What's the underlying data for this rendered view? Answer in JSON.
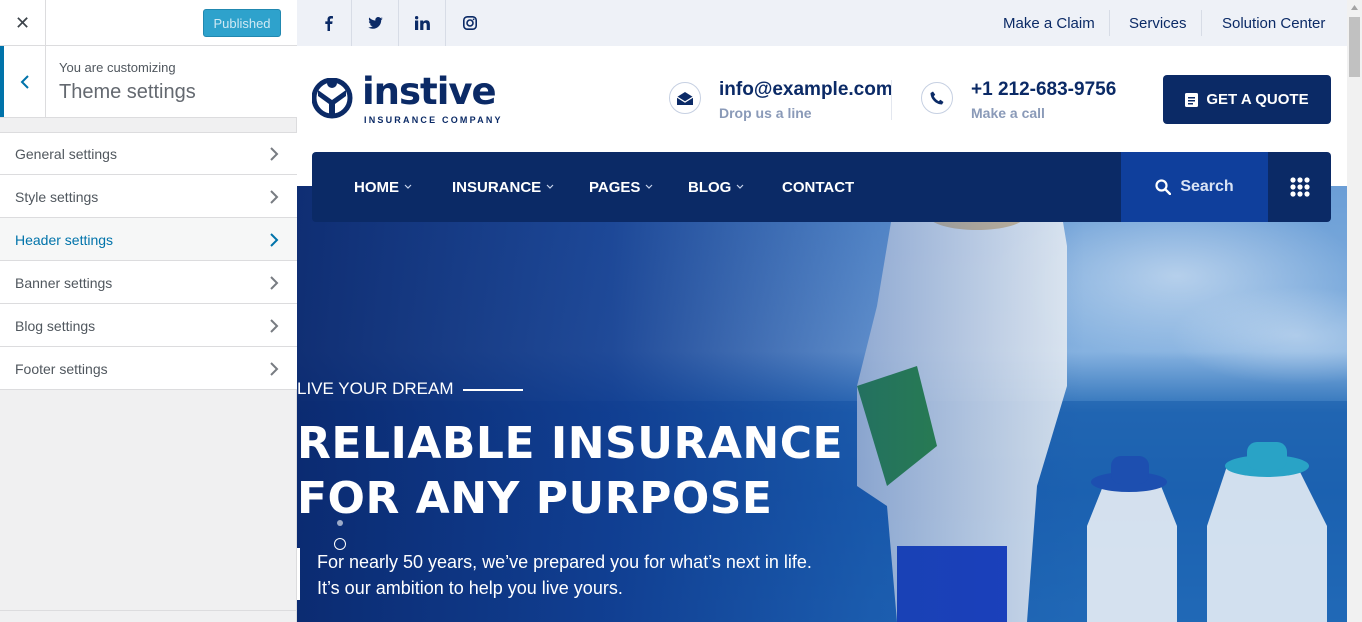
{
  "customizer": {
    "close_icon": "close-icon",
    "publish_label": "Published",
    "customizing_label": "You are customizing",
    "theme_title": "Theme settings",
    "menu": [
      {
        "label": "General settings"
      },
      {
        "label": "Style settings"
      },
      {
        "label": "Header settings",
        "active": true
      },
      {
        "label": "Banner settings"
      },
      {
        "label": "Blog settings"
      },
      {
        "label": "Footer settings"
      }
    ],
    "accent_color": "#0073aa",
    "publish_color": "#2ea2cc"
  },
  "site": {
    "topbar": {
      "social": [
        "facebook-icon",
        "twitter-icon",
        "linkedin-icon",
        "instagram-icon"
      ],
      "links": [
        "Make a Claim",
        "Services",
        "Solution Center"
      ]
    },
    "logo": {
      "name": "instive",
      "tagline": "INSURANCE COMPANY"
    },
    "contacts": [
      {
        "icon": "envelope-icon",
        "main": "info@example.com",
        "sub": "Drop us a line"
      },
      {
        "icon": "phone-icon",
        "main": "+1 212-683-9756",
        "sub": "Make a call"
      }
    ],
    "quote_button": "GET A QUOTE",
    "nav": {
      "items": [
        {
          "label": "HOME",
          "dropdown": true
        },
        {
          "label": "INSURANCE",
          "dropdown": true
        },
        {
          "label": "PAGES",
          "dropdown": true
        },
        {
          "label": "BLOG",
          "dropdown": true
        },
        {
          "label": "CONTACT",
          "dropdown": false
        }
      ],
      "search_label": "Search"
    },
    "hero": {
      "kicker": "LIVE YOUR DREAM",
      "title_line1": "RELIABLE INSURANCE",
      "title_line2": "FOR ANY PURPOSE",
      "sub_line1": "For nearly 50 years, we’ve prepared you for what’s next in life.",
      "sub_line2": "It’s our ambition to help you live yours."
    },
    "brand_color": "#0b2a66"
  }
}
